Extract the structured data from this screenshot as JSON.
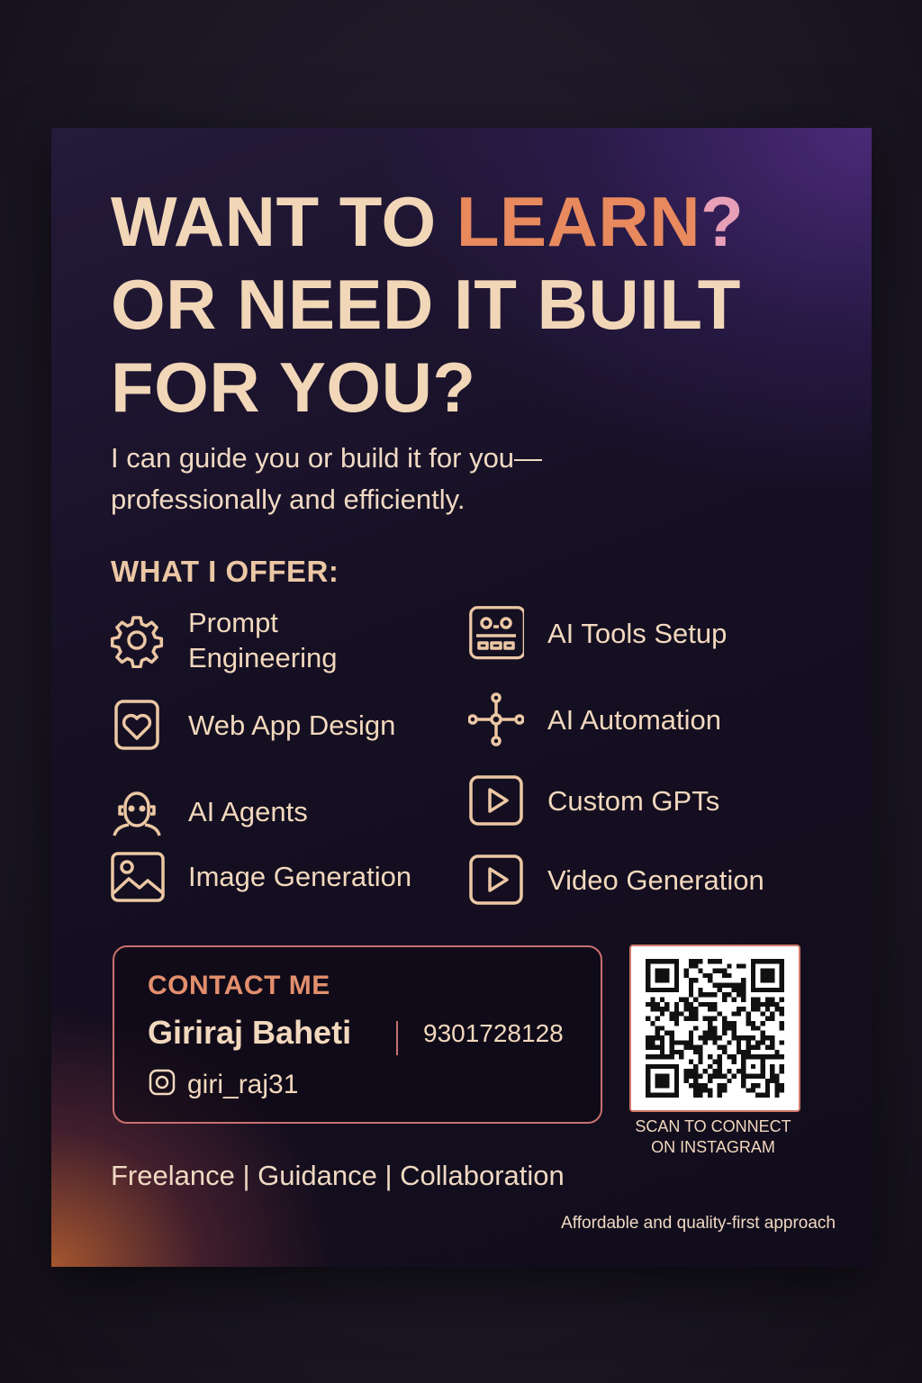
{
  "headline": {
    "line1_prefix": "WANT TO ",
    "line1_highlight": "LEARN",
    "line1_mark": "?",
    "line2": "OR NEED IT BUILT",
    "line3": "FOR YOU?"
  },
  "subtitle": {
    "line1": "I can guide you or build it for you—",
    "line2": "professionally and efficiently."
  },
  "offer": {
    "title": "WHAT I OFFER:",
    "items": [
      {
        "label": "Prompt Engineering",
        "icon": "gear-icon"
      },
      {
        "label": "AI Tools Setup",
        "icon": "robot-icon"
      },
      {
        "label": "Web App Design",
        "icon": "heart-app-icon"
      },
      {
        "label": "AI Automation",
        "icon": "network-icon"
      },
      {
        "label": "AI Agents",
        "icon": "agent-head-icon"
      },
      {
        "label": "Custom GPTs",
        "icon": "play-icon"
      },
      {
        "label": "Image Generation",
        "icon": "image-icon"
      },
      {
        "label": "Video Generation",
        "icon": "play-icon"
      }
    ]
  },
  "contact": {
    "title": "CONTACT ME",
    "name": "Giriraj Baheti",
    "phone": "9301728128",
    "instagram": "giri_raj31"
  },
  "qr": {
    "caption_line1": "SCAN TO CONNECT",
    "caption_line2": "ON INSTAGRAM"
  },
  "tagline": "Freelance | Guidance | Collaboration",
  "footnote": "Affordable and quality-first approach",
  "colors": {
    "accent_orange": "#e8895e",
    "accent_pink": "#e7a0b8",
    "text_cream": "#f2d8bd",
    "border_coral": "#c9706e"
  }
}
